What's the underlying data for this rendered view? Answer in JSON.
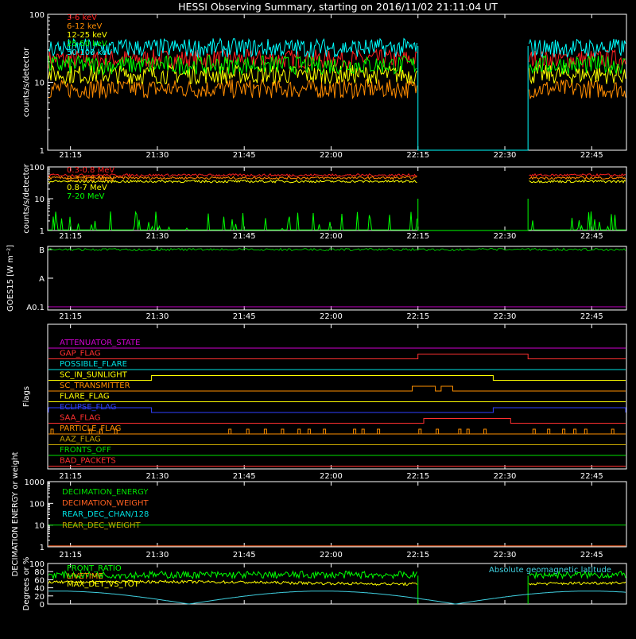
{
  "title": "HESSI Observing Summary, starting on 2016/11/02 21:11:04 UT",
  "x_tick_labels": [
    "21:15",
    "21:30",
    "21:45",
    "22:00",
    "22:15",
    "22:30",
    "22:45"
  ],
  "chart_data": [
    {
      "type": "line",
      "ylabel": "counts/s/detector",
      "yscale": "log",
      "ylim": [
        1,
        100
      ],
      "y_tick_labels": [
        "1",
        "10",
        "100"
      ],
      "gap": [
        "22:15",
        "22:34"
      ],
      "series": [
        {
          "name": "3-6 keV",
          "color": "#ff2020",
          "level": 22
        },
        {
          "name": "6-12 keV",
          "color": "#ff8c00",
          "level": 8
        },
        {
          "name": "12-25 keV",
          "color": "#ffff00",
          "level": 13
        },
        {
          "name": "25-50 keV",
          "color": "#00ff00",
          "level": 18
        },
        {
          "name": "50-100 keV",
          "color": "#00ffff",
          "level": 32
        }
      ]
    },
    {
      "type": "line",
      "ylabel": "counts/s/detector",
      "yscale": "log",
      "ylim": [
        1,
        100
      ],
      "y_tick_labels": [
        "1",
        "10",
        "100"
      ],
      "gap": [
        "22:15",
        "22:34"
      ],
      "series": [
        {
          "name": "0.3-0.8 MeV",
          "color": "#ff2020",
          "level": 55
        },
        {
          "name": "0.3-0.8 MeV",
          "color": "#ff8c00",
          "level": 45
        },
        {
          "name": "0.8-7 MeV",
          "color": "#ffff00",
          "level": 35
        },
        {
          "name": "7-20 MeV",
          "color": "#00ff00",
          "level": 1.2
        }
      ]
    },
    {
      "type": "line",
      "ylabel": "GOES15 [W m⁻²]",
      "y_tick_labels": [
        "A0.1",
        "A",
        "B"
      ],
      "series": [
        {
          "name": "GOES low",
          "color": "#00c000",
          "level_text": "B"
        },
        {
          "name": "baseline",
          "color": "#c000c0",
          "level_text": "A0.1"
        }
      ]
    },
    {
      "type": "line",
      "ylabel": "Flags",
      "flags": [
        {
          "name": "ATTENUATOR_STATE",
          "color": "#d000d0",
          "on": []
        },
        {
          "name": "GAP_FLAG",
          "color": "#ff3030",
          "on": [
            [
              "22:15",
              "22:34"
            ]
          ]
        },
        {
          "name": "POSSIBLE_FLARE",
          "color": "#00e0e0",
          "on": []
        },
        {
          "name": "SC_IN_SUNLIGHT",
          "color": "#ffff00",
          "on": [
            [
              "21:29",
              "22:28"
            ]
          ]
        },
        {
          "name": "SC_TRANSMITTER",
          "color": "#ff9000",
          "on": [
            [
              "22:14",
              "22:18"
            ],
            [
              "22:19",
              "22:21"
            ]
          ]
        },
        {
          "name": "FLARE_FLAG",
          "color": "#ffff00",
          "on": []
        },
        {
          "name": "ECLIPSE_FLAG",
          "color": "#3040ff",
          "on": [
            [
              "21:11",
              "21:29"
            ],
            [
              "22:28",
              "22:51"
            ]
          ]
        },
        {
          "name": "SAA_FLAG",
          "color": "#ff3030",
          "on": [
            [
              "22:16",
              "22:31"
            ]
          ]
        },
        {
          "name": "PARTICLE_FLAG",
          "color": "#ff9000",
          "on": []
        },
        {
          "name": "AAZ_FLAG",
          "color": "#c0a000",
          "on": []
        },
        {
          "name": "FRONTS_OFF",
          "color": "#00e000",
          "on": []
        },
        {
          "name": "BAD_PACKETS",
          "color": "#ff3030",
          "on": []
        }
      ]
    },
    {
      "type": "line",
      "ylabel": "DECIMATION ENERGY or weight",
      "yscale": "log",
      "ylim": [
        1,
        1000
      ],
      "y_tick_labels": [
        "1",
        "10",
        "100",
        "1000"
      ],
      "series": [
        {
          "name": "DECIMATION_ENERGY",
          "color": "#00e000",
          "level": 10
        },
        {
          "name": "DECIMATION_WEIGHT",
          "color": "#ff6020",
          "level": 1.1
        },
        {
          "name": "REAR_DEC_CHAN/128",
          "color": "#00e0e0",
          "level": 0
        },
        {
          "name": "REAR_DEC_WEIGHT",
          "color": "#c0a000",
          "level": 0
        }
      ]
    },
    {
      "type": "line",
      "ylabel": "Degrees or %",
      "ylim": [
        0,
        100
      ],
      "y_tick_labels": [
        "0",
        "20",
        "40",
        "60",
        "80",
        "100"
      ],
      "series": [
        {
          "name": "FRONT_RATIO",
          "color": "#00ff00",
          "level": 72
        },
        {
          "name": "LIVETIME",
          "color": "#ff9000",
          "level": 0
        },
        {
          "name": "MAX_DET_VS_TOT",
          "color": "#ffff00",
          "level": 52
        },
        {
          "name": "Absolute geomagnetic latitude",
          "color": "#40d0e0",
          "level": null
        }
      ]
    }
  ]
}
